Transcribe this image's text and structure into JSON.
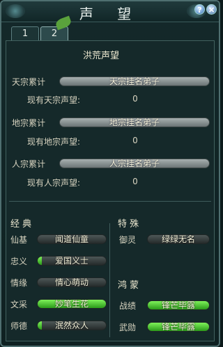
{
  "window": {
    "title": "声 望"
  },
  "tabs": [
    "1",
    "2"
  ],
  "section_title": "洪荒声望",
  "factions": [
    {
      "label": "天宗累计",
      "rank": "天宗挂名弟子",
      "current_label": "现有天宗声望:",
      "current_value": "0"
    },
    {
      "label": "地宗累计",
      "rank": "地宗挂名弟子",
      "current_label": "现有地宗声望:",
      "current_value": "0"
    },
    {
      "label": "人宗累计",
      "rank": "人宗挂名弟子",
      "current_label": "现有人宗声望:",
      "current_value": "0"
    }
  ],
  "classic": {
    "heading": "经  典",
    "items": [
      {
        "label": "仙基",
        "value": "闻道仙童",
        "progress": 0
      },
      {
        "label": "忠义",
        "value": "爱国义士",
        "progress": 0.06
      },
      {
        "label": "情缘",
        "value": "情心萌动",
        "progress": 0
      },
      {
        "label": "文采",
        "value": "妙笔生花",
        "progress": 1
      },
      {
        "label": "师德",
        "value": "泯然众人",
        "progress": 0.06
      }
    ]
  },
  "special": {
    "heading": "特  殊",
    "items": [
      {
        "label": "御灵",
        "value": "绿绿无名",
        "progress": 0
      }
    ]
  },
  "hongmeng": {
    "heading": "鸿  蒙",
    "items": [
      {
        "label": "战绩",
        "value": "锋芒毕露",
        "progress": 1
      },
      {
        "label": "武勋",
        "value": "锋芒毕露",
        "progress": 1
      }
    ]
  }
}
